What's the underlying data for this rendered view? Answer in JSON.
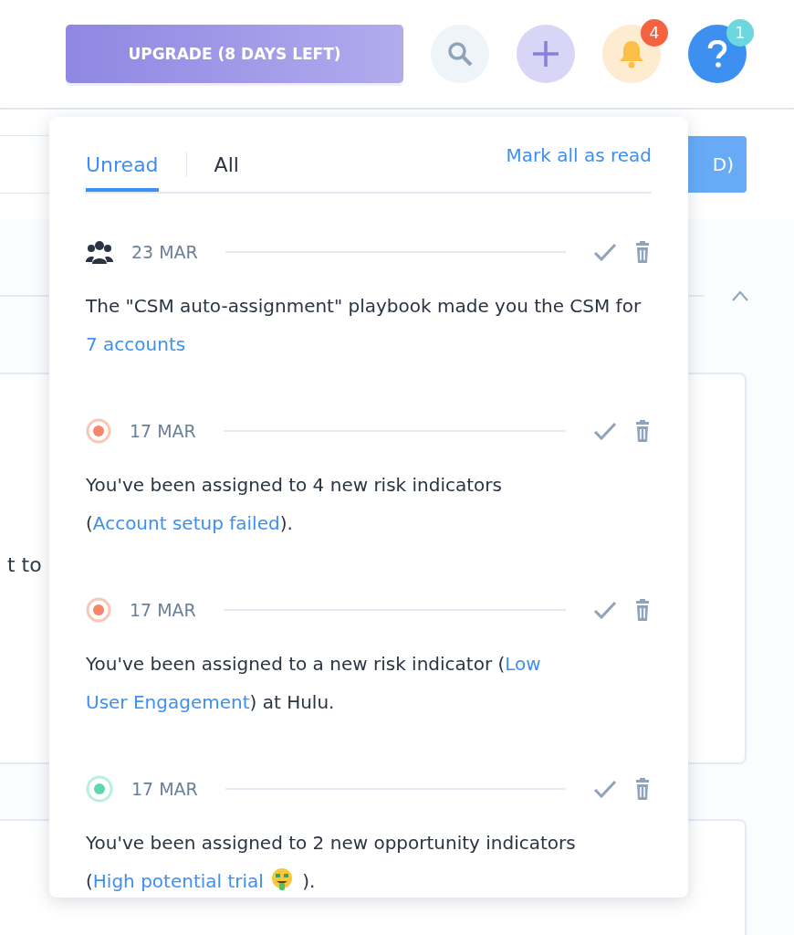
{
  "header": {
    "upgrade_button": "UPGRADE (8 DAYS LEFT)",
    "buttons": [
      {
        "kind": "search"
      },
      {
        "kind": "add"
      },
      {
        "kind": "bell",
        "badge": "4"
      },
      {
        "kind": "help",
        "badge": "1"
      }
    ]
  },
  "background": {
    "button_text": "D)",
    "card_text": "t to"
  },
  "notifications": {
    "tabs": [
      {
        "label": "Unread",
        "selected": true
      },
      {
        "label": "All",
        "selected": false
      }
    ],
    "mark_all": "Mark all as read",
    "items": [
      {
        "kind": "team",
        "date": "23 MAR",
        "parts": [
          {
            "kind": "text",
            "text": "The \"CSM auto-assignment\" playbook made you the CSM for "
          },
          {
            "kind": "link",
            "text": "7 accounts"
          }
        ]
      },
      {
        "kind": "risk",
        "date": "17 MAR",
        "parts": [
          {
            "kind": "text",
            "text": "You've been assigned to 4 new risk indicators ("
          },
          {
            "kind": "link",
            "text": "Account setup failed"
          },
          {
            "kind": "text",
            "text": ")."
          }
        ]
      },
      {
        "kind": "risk",
        "date": "17 MAR",
        "parts": [
          {
            "kind": "text",
            "text": "You've been assigned to a new risk indicator ("
          },
          {
            "kind": "link",
            "text": "Low"
          },
          {
            "kind": "link",
            "text": "User Engagement"
          },
          {
            "kind": "text",
            "text": ") at Hulu."
          }
        ]
      },
      {
        "kind": "opportunity",
        "date": "17 MAR",
        "parts": [
          {
            "kind": "text",
            "text": "You've been assigned to 2 new opportunity indicators ("
          },
          {
            "kind": "link",
            "text": "High potential trial"
          },
          {
            "kind": "emoji"
          },
          {
            "kind": "text",
            "text": " )."
          }
        ]
      }
    ]
  }
}
